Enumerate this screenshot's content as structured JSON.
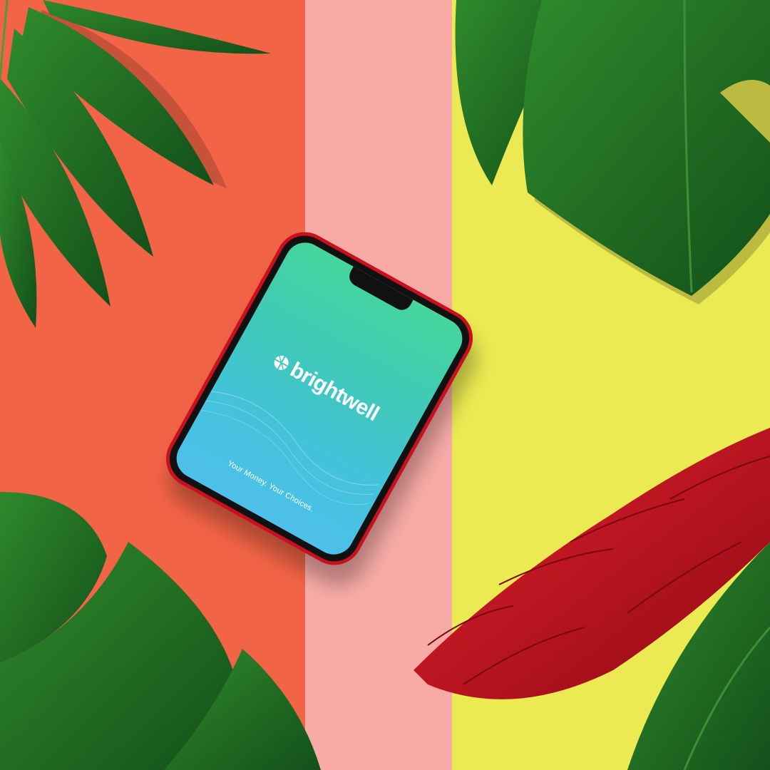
{
  "scene": {
    "background_stripes": [
      {
        "name": "coral",
        "color": "#f26446"
      },
      {
        "name": "pink",
        "color": "#f7aaa6"
      },
      {
        "name": "yellow",
        "color": "#ecea52"
      }
    ],
    "leaf_color": "#1f6b22",
    "flower_color": "#c9101e",
    "phone_color": "#c8101e"
  },
  "screen": {
    "brand_name": "brightwell",
    "brand_logo_icon": "globe-icon",
    "tagline": "Your Money. Your Choices.",
    "gradient_top": "#45d79e",
    "gradient_bottom": "#4ec0ea"
  }
}
